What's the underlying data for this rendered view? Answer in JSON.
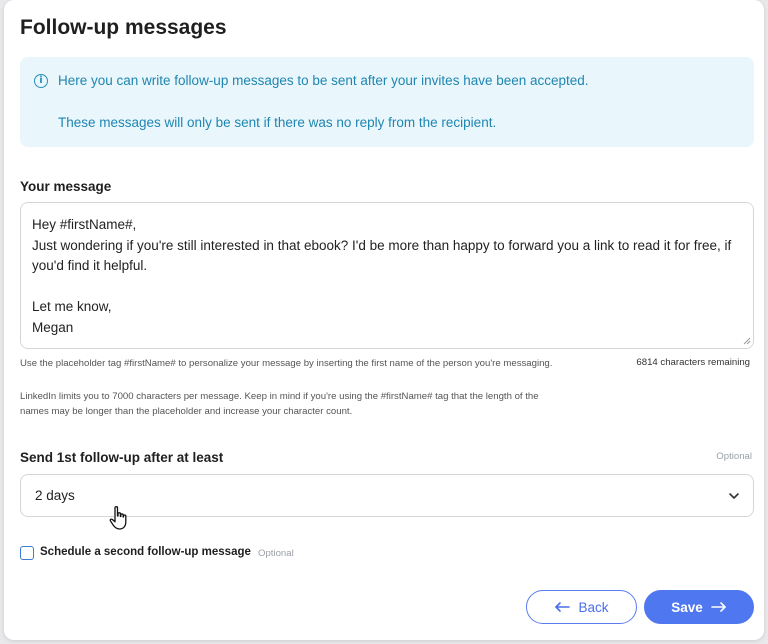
{
  "page": {
    "title": "Follow-up messages"
  },
  "info": {
    "line1": "Here you can write follow-up messages to be sent after your invites have been accepted.",
    "line2": "These messages will only be sent if there was no reply from the recipient.",
    "icon": "info-icon"
  },
  "message": {
    "label": "Your message",
    "value": "Hey #firstName#,\nJust wondering if you're still interested in that ebook? I'd be more than happy to forward you a link to read it for free, if you'd find it helpful.\n\nLet me know,\nMegan",
    "hint1": "Use the placeholder tag #firstName# to personalize your message by inserting the first name of the person you're messaging.",
    "hint2": "LinkedIn limits you to 7000 characters per message. Keep in mind if you're using the #firstName# tag that the length of the names may be longer than the placeholder and increase your character count.",
    "remaining": "6814 characters remaining"
  },
  "followup": {
    "label": "Send 1st follow-up after at least",
    "optional": "Optional",
    "selected": "2 days"
  },
  "second": {
    "label": "Schedule a second follow-up message",
    "optional": "Optional",
    "checked": false
  },
  "actions": {
    "back_label": "Back",
    "save_label": "Save"
  },
  "colors": {
    "accent": "#4f77f0",
    "info_bg": "#e9f6fb",
    "info_text": "#1f86b1"
  }
}
